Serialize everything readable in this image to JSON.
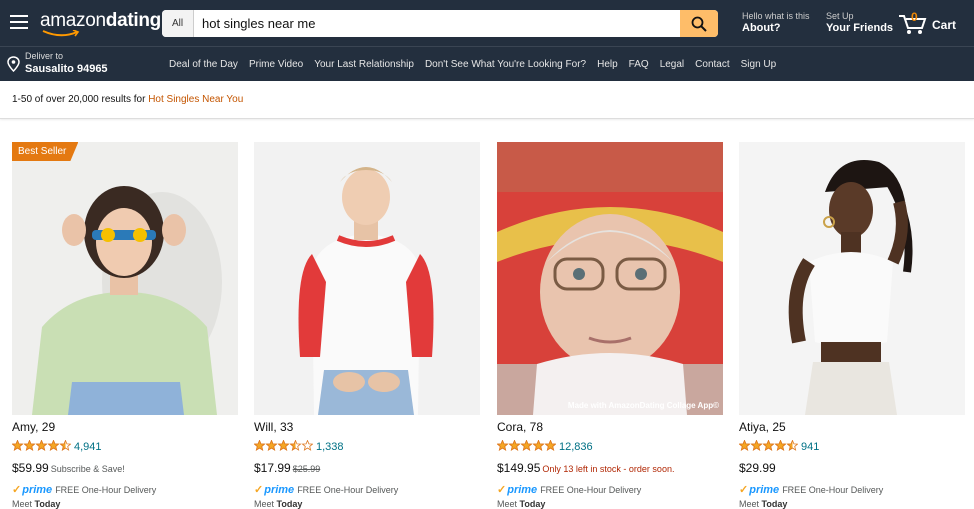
{
  "header": {
    "logo_part1": "amazon",
    "logo_part2": "dating",
    "search_category": "All",
    "search_value": "hot singles near me",
    "about_small": "Hello what is this",
    "about_big": "About?",
    "friends_small": "Set Up",
    "friends_big": "Your Friends",
    "cart_count": "0",
    "cart_label": "Cart"
  },
  "subnav": {
    "deliver_to": "Deliver to",
    "location": "Sausalito 94965",
    "links": [
      "Deal of the Day",
      "Prime Video",
      "Your Last Relationship",
      "Don't See What You're Looking For?",
      "Help",
      "FAQ",
      "Legal",
      "Contact",
      "Sign Up"
    ]
  },
  "results": {
    "prefix": "1-50 of over 20,000 results for ",
    "query": "Hot Singles Near You"
  },
  "cards": [
    {
      "badge": "Best Seller",
      "name": "Amy, 29",
      "rating": 4.5,
      "reviews": "4,941",
      "price": "$59.99",
      "note": "Subscribe & Save!",
      "prime": "prime",
      "delivery": "FREE One-Hour Delivery",
      "meet_prefix": "Meet ",
      "meet_day": "Today"
    },
    {
      "name": "Will, 33",
      "rating": 3.5,
      "reviews": "1,338",
      "price": "$17.99",
      "was": "$25.99",
      "prime": "prime",
      "delivery": "FREE One-Hour Delivery",
      "meet_prefix": "Meet ",
      "meet_day": "Today"
    },
    {
      "name": "Cora, 78",
      "rating": 5,
      "reviews": "12,836",
      "price": "$149.95",
      "stock": "Only 13 left in stock - order soon.",
      "collage": "Made with AmazonDating Collage App©",
      "prime": "prime",
      "delivery": "FREE One-Hour Delivery",
      "meet_prefix": "Meet ",
      "meet_day": "Today"
    },
    {
      "name": "Atiya, 25",
      "rating": 4.5,
      "reviews": "941",
      "price": "$29.99",
      "prime": "prime",
      "delivery": "FREE One-Hour Delivery",
      "meet_prefix": "Meet ",
      "meet_day": "Today"
    }
  ],
  "colors": {
    "nav": "#232f3e",
    "search_button": "#febd69",
    "badge": "#e47911",
    "star": "#f5a623",
    "link": "#007185",
    "query": "#c45500",
    "stock": "#b12704",
    "prime": "#1a98ff"
  }
}
